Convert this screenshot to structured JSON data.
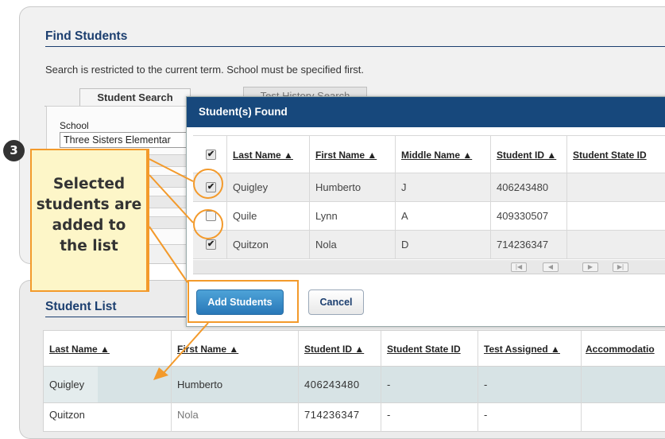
{
  "find": {
    "title": "Find Students",
    "helper": "Search is restricted to the current term. School must be specified first.",
    "tabs": [
      "Student Search",
      "Test History Search"
    ],
    "school_label": "School",
    "school_value": "Three Sisters Elementar"
  },
  "modal": {
    "title": "Student(s) Found",
    "columns": [
      "Last Name ▲",
      "First Name ▲",
      "Middle Name ▲",
      "Student ID ▲",
      "Student State ID"
    ],
    "rows": [
      {
        "last": "Quigley",
        "first": "Humberto",
        "middle": "J",
        "id": "406243480",
        "state_id": "",
        "checked": true
      },
      {
        "last": "Quile",
        "first": "Lynn",
        "middle": "A",
        "id": "409330507",
        "state_id": "",
        "checked": false
      },
      {
        "last": "Quitzon",
        "first": "Nola",
        "middle": "D",
        "id": "714236347",
        "state_id": "",
        "checked": true
      }
    ],
    "add_label": "Add Students",
    "cancel_label": "Cancel"
  },
  "list": {
    "title": "Student List",
    "columns": [
      "Last Name ▲",
      "First Name ▲",
      "Student ID ▲",
      "Student State ID",
      "Test Assigned ▲",
      "Accommodatio"
    ],
    "rows": [
      {
        "last": "Quigley",
        "first": "Humberto",
        "id": "406243480",
        "state_id": "-",
        "test": "-"
      },
      {
        "last": "Quitzon",
        "first": "Nola",
        "id": "714236347",
        "state_id": "-",
        "test": "-"
      }
    ]
  },
  "callout": {
    "step": "3",
    "lines": [
      "Selected",
      "students are",
      "added to",
      "the list"
    ]
  },
  "colors": {
    "header_blue": "#17487c",
    "title_blue": "#1b3e6f",
    "accent_orange": "#f39a2b",
    "callout_bg": "#fdf6c8"
  }
}
